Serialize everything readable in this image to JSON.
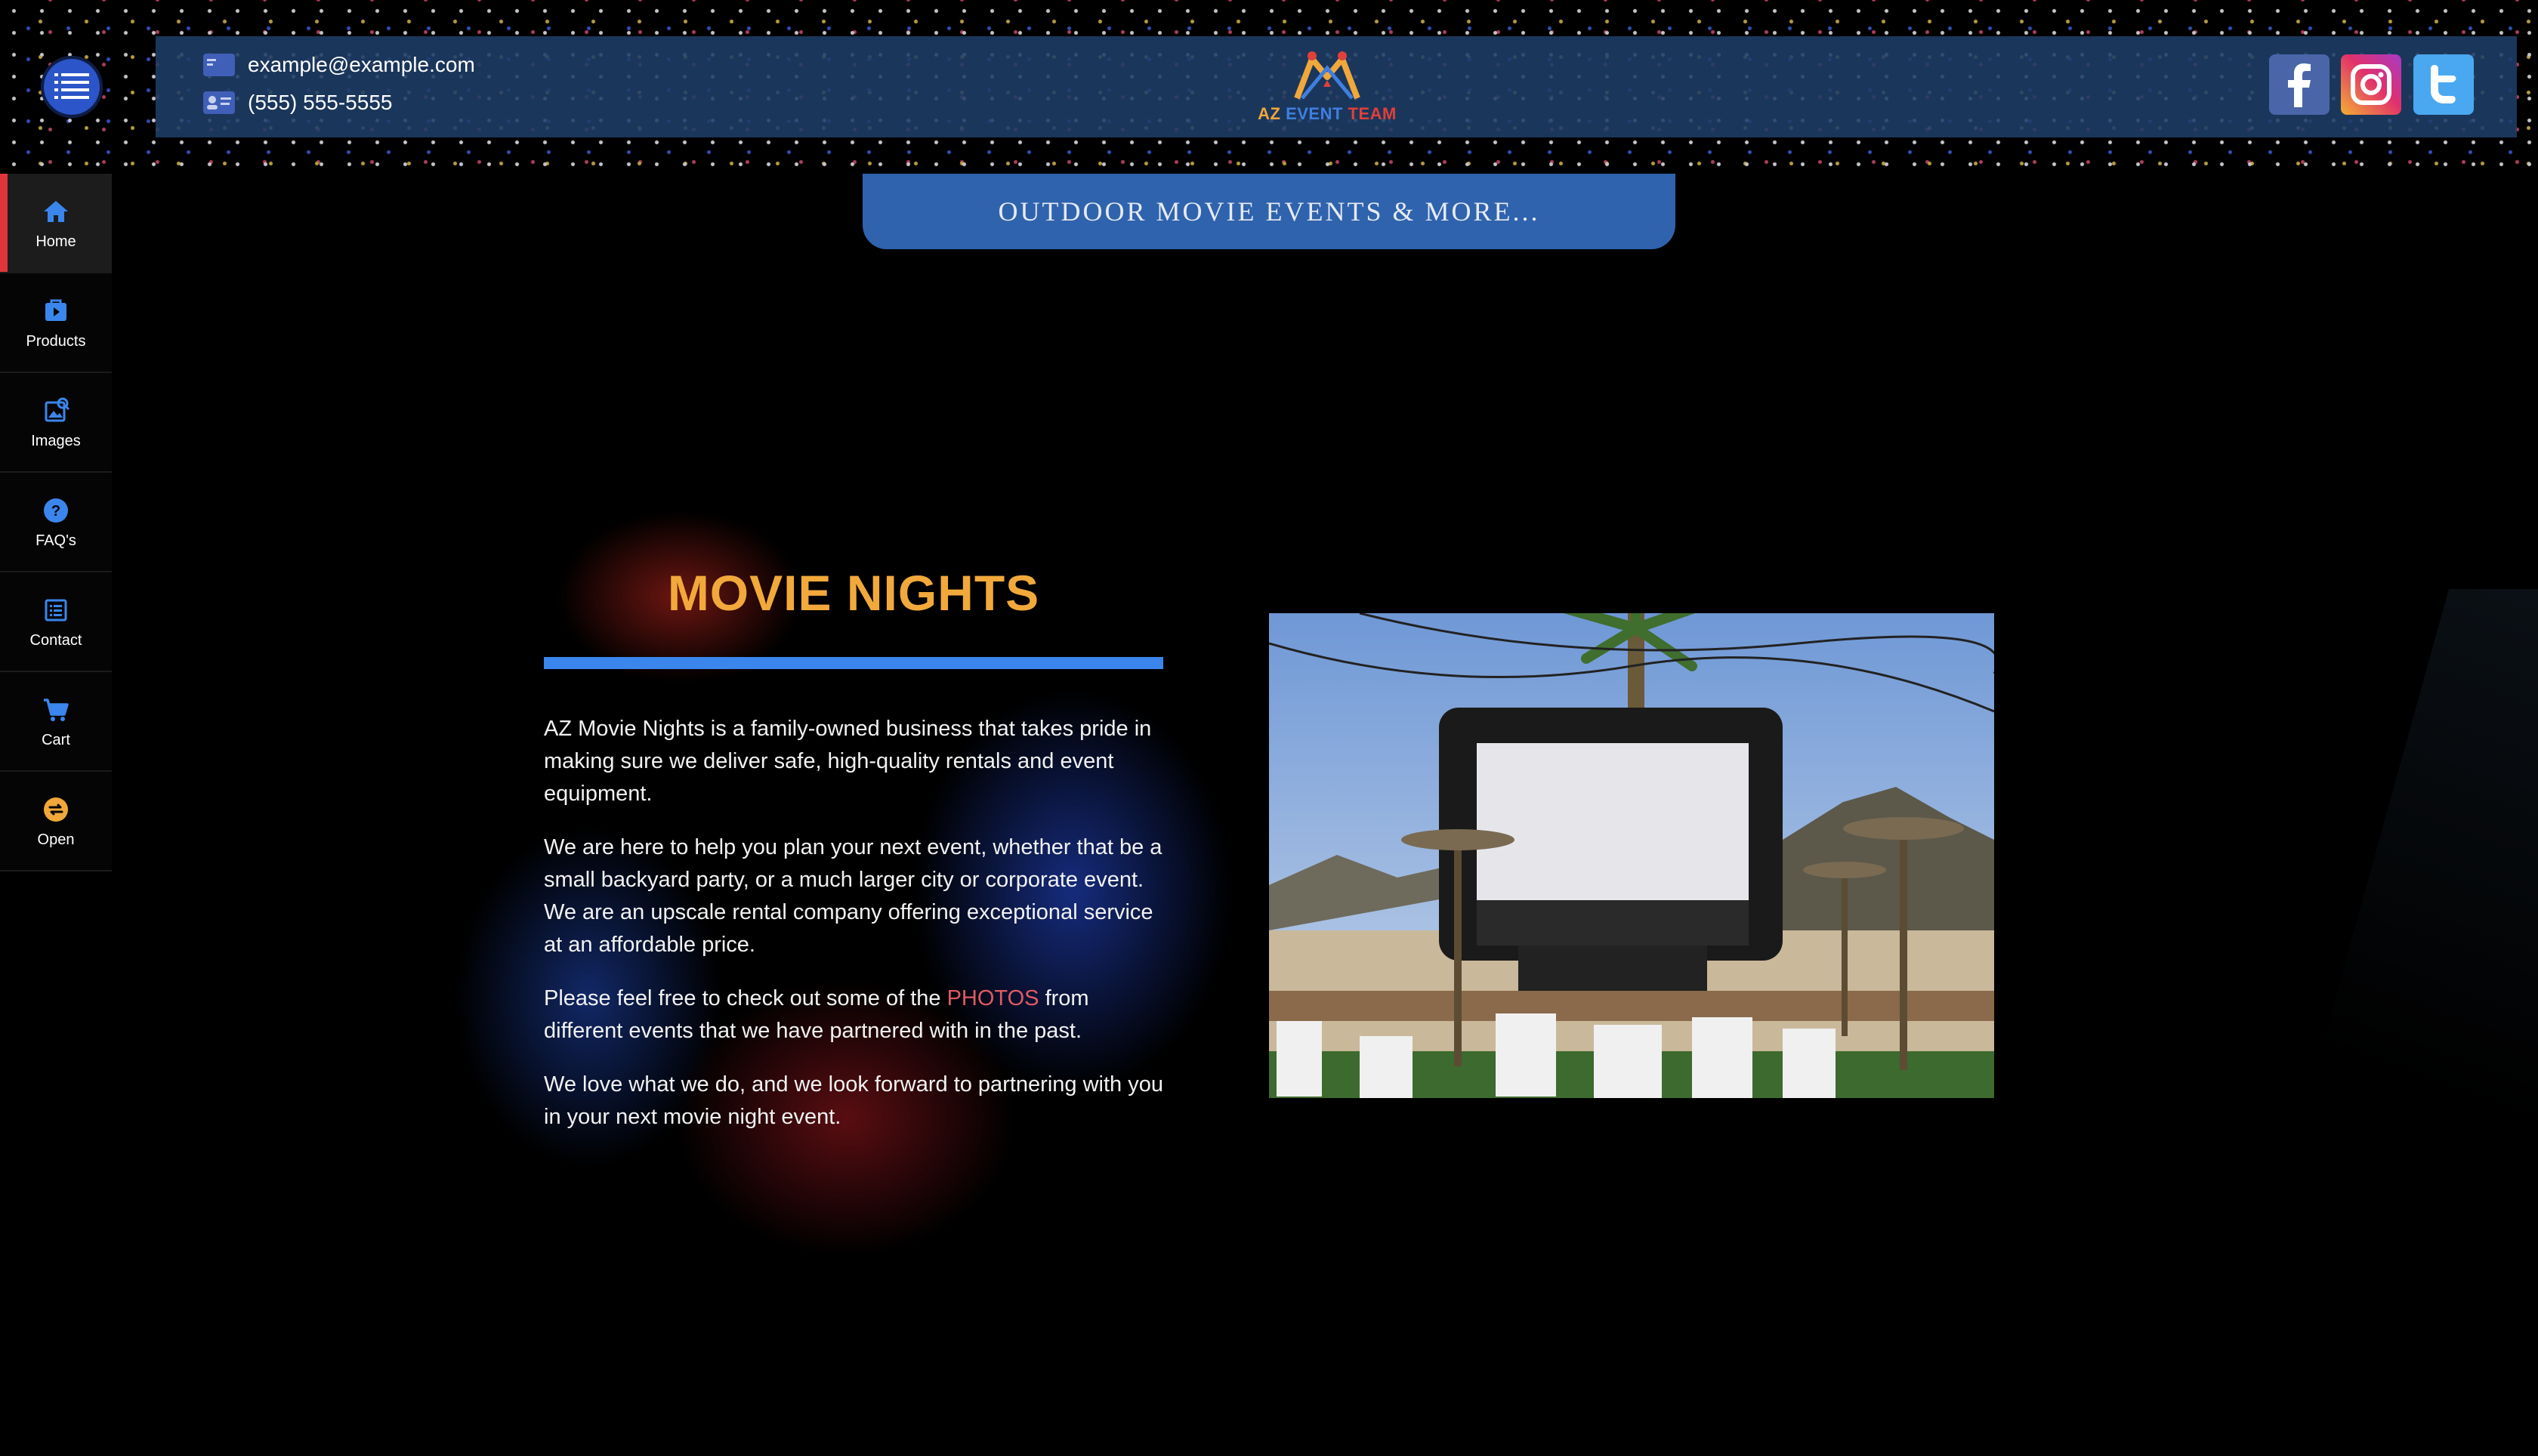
{
  "header": {
    "email": "example@example.com",
    "phone": "(555) 555-5555",
    "logo": {
      "part1": "AZ",
      "part2": "EVENT",
      "part3": "TEAM"
    },
    "social": [
      "facebook-icon",
      "instagram-icon",
      "twitter-icon"
    ]
  },
  "banner": {
    "label": "OUTDOOR MOVIE EVENTS & MORE..."
  },
  "sidebar": {
    "items": [
      {
        "label": "Home",
        "icon": "home-icon",
        "active": true
      },
      {
        "label": "Products",
        "icon": "products-icon"
      },
      {
        "label": "Images",
        "icon": "images-icon"
      },
      {
        "label": "FAQ's",
        "icon": "help-icon"
      },
      {
        "label": "Contact",
        "icon": "contact-icon"
      },
      {
        "label": "Cart",
        "icon": "cart-icon"
      },
      {
        "label": "Open",
        "icon": "swap-icon"
      }
    ]
  },
  "main": {
    "title": "MOVIE NIGHTS",
    "para1": "AZ Movie Nights is a family-owned business that takes pride in making sure we deliver safe, high-quality rentals and event equipment.",
    "para2": "We are here to help you plan your next event, whether that be a small backyard party, or a much larger city or corporate event. We are an upscale rental company offering exceptional service at an affordable price.",
    "para3_before": "Please feel free to check out some of the ",
    "para3_link": "PHOTOS",
    "para3_after": " from different events that we have partnered with in the past.",
    "para4": "We love what we do, and we look forward to partnering with you in your next movie night event."
  },
  "colors": {
    "accent_orange": "#f2a93b",
    "accent_blue": "#3a86ec",
    "header_bar": "#1f3d68",
    "banner": "#2f63ad",
    "active_marker": "#e0353a",
    "link": "#e05a62"
  }
}
